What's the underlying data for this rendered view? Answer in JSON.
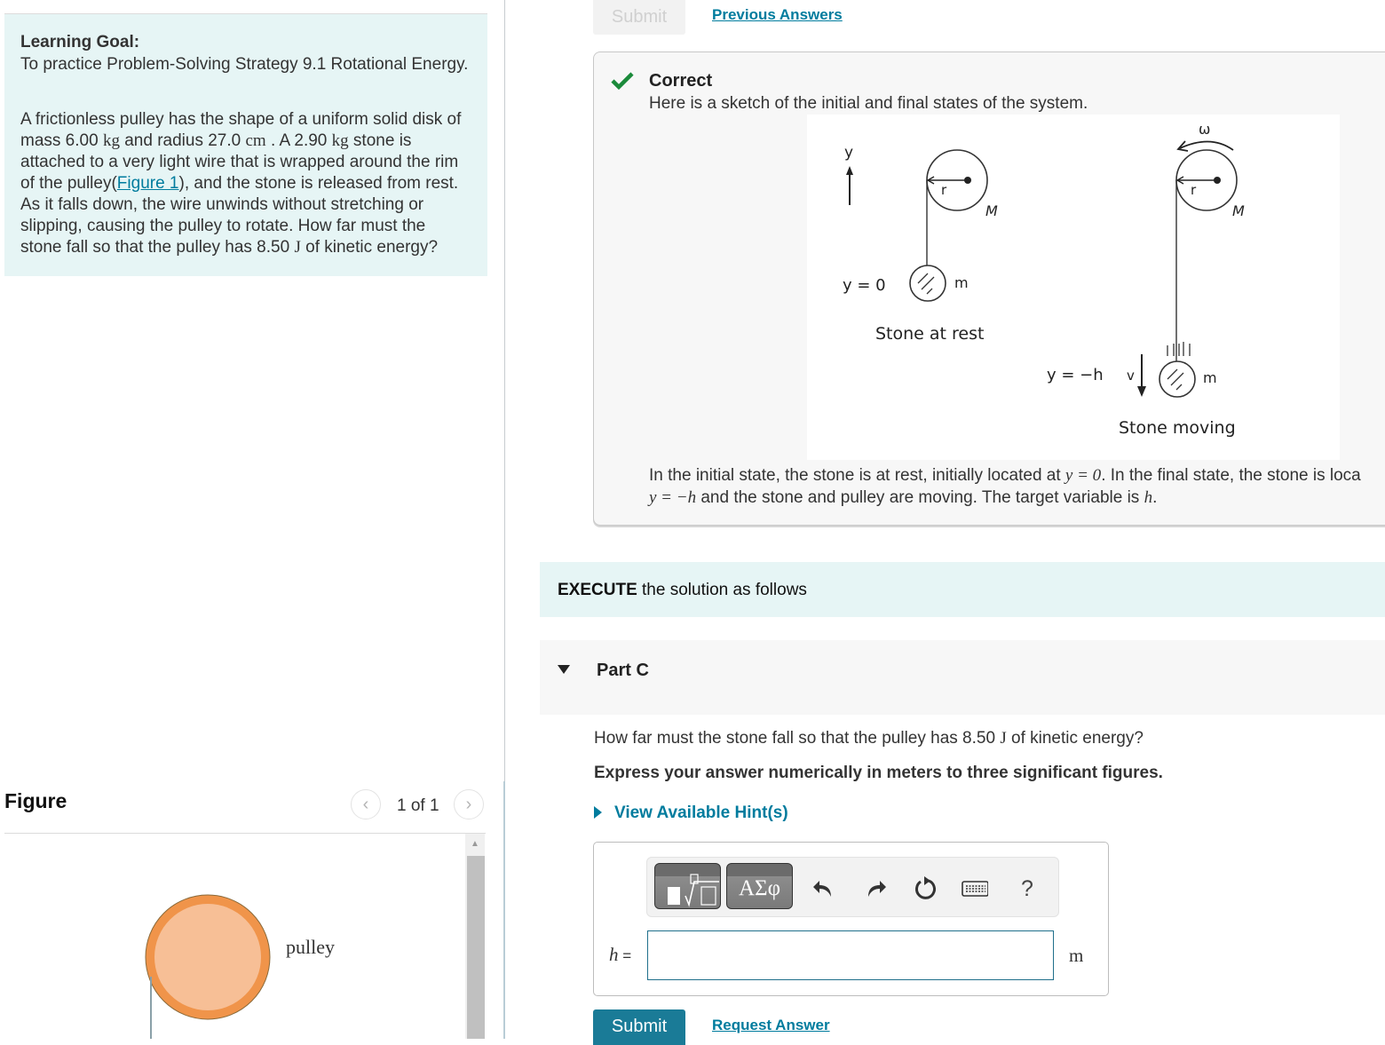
{
  "left": {
    "learning_goal": {
      "title": "Learning Goal:",
      "text": "To practice Problem-Solving Strategy 9.1 Rotational Energy."
    },
    "problem": {
      "part1": "A frictionless pulley has the shape of a uniform solid disk of mass 6.00 ",
      "unit_kg": "kg",
      "part2": " and radius 27.0 ",
      "unit_cm": "cm",
      "part3": " . A 2.90 ",
      "unit_kg2": "kg",
      "part4": " stone is attached to a very light wire that is wrapped around the rim of the pulley(",
      "figure_link": "Figure 1",
      "part5": "), and the stone is released from rest. As it falls down, the wire unwinds without stretching or slipping, causing the pulley to rotate. How far must the stone fall so that the pulley has 8.50 ",
      "unit_J": "J",
      "part6": " of kinetic energy?"
    },
    "figure": {
      "title": "Figure",
      "counter": "1 of 1",
      "prev_icon": "chevron-left-icon",
      "next_icon": "chevron-right-icon",
      "pulley_label": "pulley",
      "colors": {
        "pulley_rim": "#f0944a",
        "pulley_face": "#f7bf96"
      }
    }
  },
  "right": {
    "top_submit_label": "Submit",
    "previous_answers_label": "Previous Answers",
    "feedback": {
      "status": "Correct",
      "status_icon": "checkmark-icon",
      "status_color": "#1a8a3a",
      "intro": "Here is a sketch of the initial and final states of the system.",
      "sketch_labels": {
        "y_axis": "y",
        "radius": "r",
        "pulley_mass": "M",
        "stone_mass": "m",
        "initial_y": "y = 0",
        "initial_caption": "Stone at rest",
        "omega": "ω",
        "final_y": "y = −h",
        "velocity": "v",
        "final_caption": "Stone moving"
      },
      "desc_line1_a": "In the initial state, the stone is at rest, initially located at ",
      "desc_line1_math": "y = 0",
      "desc_line1_b": ". In the final state, the stone is loca",
      "desc_line2_math": "y = −h",
      "desc_line2_a": " and the stone and pulley are moving. The target variable is ",
      "desc_line2_var": "h",
      "desc_line2_b": "."
    },
    "execute": {
      "bold": "EXECUTE",
      "rest": " the solution as follows"
    },
    "part": {
      "label": "Part C",
      "question_a": "How far must the stone fall so that the pulley has 8.50 ",
      "question_unit": "J",
      "question_b": " of kinetic energy?",
      "instruction": "Express your answer numerically in meters to three significant figures.",
      "hint_label": "View Available Hint(s)"
    },
    "answer": {
      "toolbar": {
        "templates_icon": "templates-icon",
        "greek_label": "ΑΣφ",
        "undo_icon": "undo-icon",
        "redo_icon": "redo-icon",
        "reset_icon": "reset-icon",
        "keyboard_icon": "keyboard-icon",
        "help_label": "?"
      },
      "variable": "h",
      "equals": " =",
      "value": "",
      "placeholder": "",
      "unit": "m"
    },
    "submit_label": "Submit",
    "request_answer_label": "Request Answer",
    "accent_color": "#007c9e"
  }
}
